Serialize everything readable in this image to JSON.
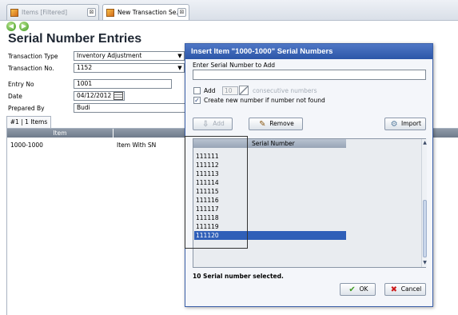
{
  "tabs": [
    {
      "label": "Items [Filtered]",
      "active": false
    },
    {
      "label": "New Transaction Se...",
      "active": true
    }
  ],
  "page_title": "Serial Number Entries",
  "form": {
    "transaction_type_label": "Transaction Type",
    "transaction_type_value": "Inventory Adjustment",
    "transaction_no_label": "Transaction No.",
    "transaction_no_value": "1152",
    "entry_no_label": "Entry No",
    "entry_no_value": "1001",
    "date_label": "Date",
    "date_value": "04/12/2012",
    "prepared_by_label": "Prepared By",
    "prepared_by_value": "Budi"
  },
  "subtab_label": "#1 | 1 Items",
  "grid": {
    "column_header": "Item",
    "rows": [
      {
        "code": "1000-1000",
        "name": "Item With SN"
      }
    ]
  },
  "dialog": {
    "title": "Insert Item \"1000-1000\" Serial Numbers",
    "enter_label": "Enter Serial Number to Add",
    "input_value": "",
    "add_checkbox_label": "Add",
    "add_count": "10",
    "consecutive_label": "consecutive numbers",
    "create_new_label": "Create new number if number not found",
    "add_checked": false,
    "create_new_checked": true,
    "add_button": "Add",
    "remove_button": "Remove",
    "import_button": "Import",
    "list_header": "Serial Number",
    "serial_numbers": [
      "111111",
      "111112",
      "111113",
      "111114",
      "111115",
      "111116",
      "111117",
      "111118",
      "111119",
      "111120"
    ],
    "selected_serial": "111120",
    "status_text": "10 Serial number selected.",
    "ok_button": "OK",
    "cancel_button": "Cancel"
  },
  "colors": {
    "title_bar": "#2c56a8",
    "selection": "#2f5fb8",
    "grid_header": "#7f8b9b"
  }
}
